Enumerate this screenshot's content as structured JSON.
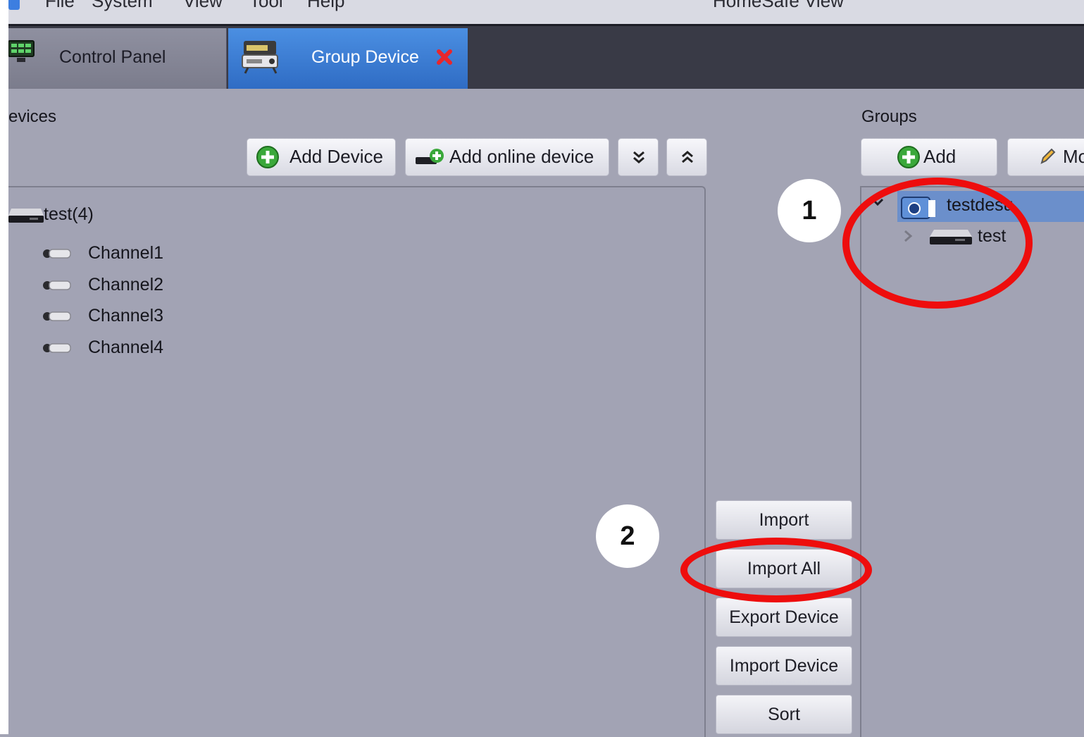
{
  "menu": {
    "items": [
      "File",
      "System",
      "View",
      "Tool",
      "Help"
    ],
    "window_title": "HomeSafe View"
  },
  "tabs": [
    {
      "label": "Control Panel",
      "icon": "monitor-icon"
    },
    {
      "label": "Group Device",
      "icon": "group-device-icon",
      "close_icon": "close-icon"
    }
  ],
  "devices": {
    "title": "evices",
    "toolbar": {
      "add_device": "Add Device",
      "add_online_device": "Add online device",
      "expand_all_icon": "double-chevron-down-icon",
      "collapse_all_icon": "double-chevron-up-icon"
    },
    "tree": {
      "device_label": "test(4)",
      "channels": [
        "Channel1",
        "Channel2",
        "Channel3",
        "Channel4"
      ]
    }
  },
  "groups": {
    "title": "Groups",
    "toolbar": {
      "add": "Add",
      "modify": "Mo"
    },
    "tree": {
      "group_label": "testdesu",
      "device_label": "test"
    }
  },
  "actions": {
    "import": "Import",
    "import_all": "Import All",
    "export_device": "Export Device",
    "import_device": "Import Device",
    "sort": "Sort"
  },
  "annotations": {
    "step1": "1",
    "step2": "2",
    "ring_color": "#ee0d0d"
  }
}
